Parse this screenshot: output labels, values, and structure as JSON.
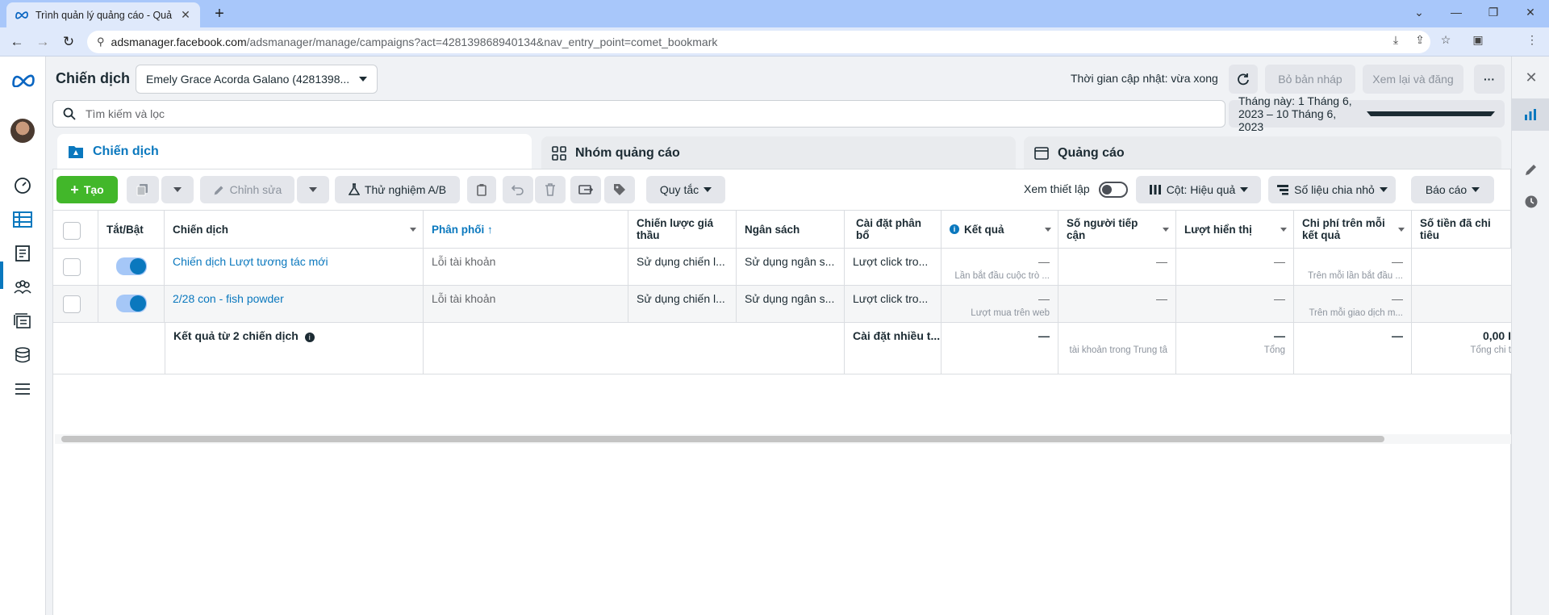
{
  "browser": {
    "tab_title": "Trình quản lý quảng cáo - Quản lý",
    "url_host": "adsmanager.facebook.com",
    "url_path": "/adsmanager/manage/campaigns?act=428139868940134&nav_entry_point=comet_bookmark"
  },
  "header": {
    "title": "Chiến dịch",
    "account": "Emely Grace Acorda Galano (4281398...",
    "updated": "Thời gian cập nhật: vừa xong",
    "discard": "Bỏ bản nháp",
    "review": "Xem lại và đăng",
    "more": "···"
  },
  "search": {
    "placeholder": "Tìm kiếm và lọc",
    "daterange": "Tháng này: 1 Tháng 6, 2023 – 10 Tháng 6, 2023"
  },
  "level_tabs": [
    {
      "label": "Chiến dịch"
    },
    {
      "label": "Nhóm quảng cáo"
    },
    {
      "label": "Quảng cáo"
    }
  ],
  "toolbar": {
    "create": "Tạo",
    "edit": "Chỉnh sửa",
    "abtest": "Thử nghiệm A/B",
    "rules": "Quy tắc",
    "view_setup": "Xem thiết lập",
    "columns": "Cột: Hiệu quả",
    "breakdown": "Số liệu chia nhỏ",
    "reports": "Báo cáo"
  },
  "table": {
    "columns": {
      "toggle": "Tắt/Bật",
      "campaign": "Chiến dịch",
      "delivery": "Phân phối ↑",
      "bid": "Chiến lược giá thầu",
      "budget": "Ngân sách",
      "attribution": "Cài đặt phân bổ",
      "results": "Kết quả",
      "reach": "Số người tiếp cận",
      "impressions": "Lượt hiển thị",
      "cost_per_result": "Chi phí trên mỗi kết quả",
      "amount_spent": "Số tiền đã chi tiêu"
    },
    "rows": [
      {
        "name": "Chiến dịch Lượt tương tác mới",
        "delivery": "Lỗi tài khoản",
        "bid": "Sử dụng chiến l...",
        "budget": "Sử dụng ngân s...",
        "attribution": "Lượt click tro...",
        "results": "—",
        "results_sub": "Lần bắt đầu cuộc trò ...",
        "reach": "—",
        "impressions": "—",
        "cost": "—",
        "cost_sub": "Trên mỗi lần bắt đầu ..."
      },
      {
        "name": "2/28 con - fish powder",
        "delivery": "Lỗi tài khoản",
        "bid": "Sử dụng chiến l...",
        "budget": "Sử dụng ngân s...",
        "attribution": "Lượt click tro...",
        "results": "—",
        "results_sub": "Lượt mua trên web",
        "reach": "—",
        "impressions": "—",
        "cost": "—",
        "cost_sub": "Trên mỗi giao dịch m..."
      }
    ],
    "total": {
      "label": "Kết quả từ 2 chiến dịch",
      "attribution": "Cài đặt nhiều t...",
      "results": "—",
      "reach_sub": "tài khoản trong Trung tâ",
      "impressions": "—",
      "impressions_sub": "Tổng",
      "cost": "—",
      "spent": "0,00 I",
      "spent_sub": "Tổng chi t"
    }
  },
  "colors": {
    "accent": "#0a78be",
    "create_green": "#42b72a"
  }
}
